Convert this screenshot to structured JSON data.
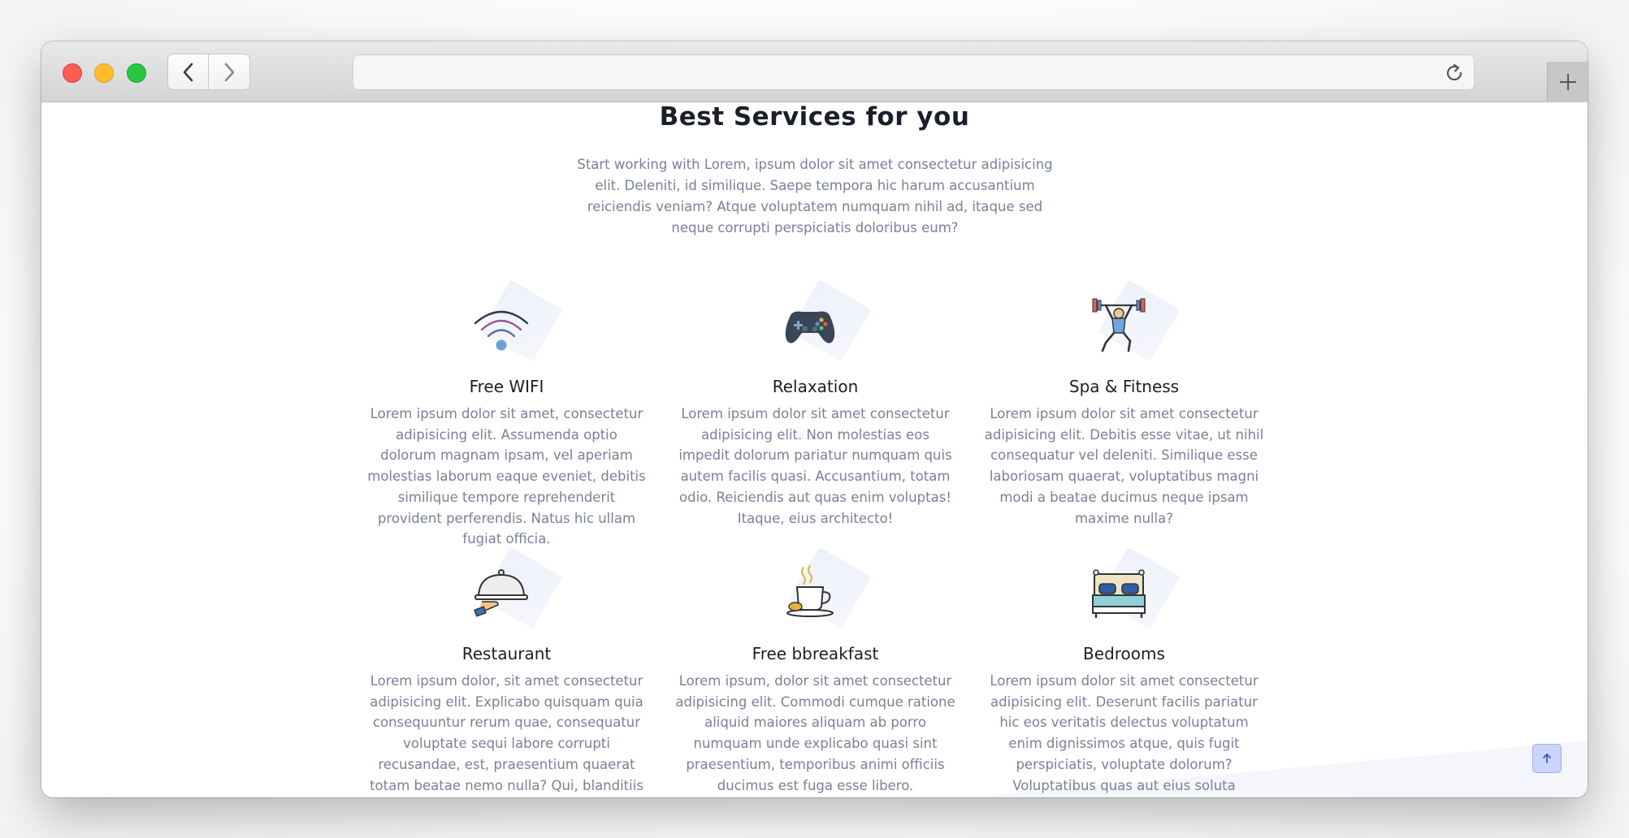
{
  "browser": {
    "url_value": "",
    "back_icon": "chevron-left-icon",
    "forward_icon": "chevron-right-icon",
    "reload_icon": "reload-icon",
    "newtab_icon": "plus-icon"
  },
  "section": {
    "title": "Best Services for you",
    "intro": "Start working with Lorem, ipsum dolor sit amet consectetur adipisicing elit. Deleniti, id similique. Saepe tempora hic harum accusantium reiciendis veniam? Atque voluptatem numquam nihil ad, itaque sed neque corrupti perspiciatis doloribus eum?"
  },
  "services": [
    {
      "icon": "wifi-icon",
      "title": "Free WIFI",
      "text": "Lorem ipsum dolor sit amet, consectetur adipisicing elit. Assumenda optio dolorum magnam ipsam, vel aperiam molestias laborum eaque eveniet, debitis similique tempore reprehenderit provident perferendis. Natus hic ullam fugiat officia."
    },
    {
      "icon": "gamepad-icon",
      "title": "Relaxation",
      "text": "Lorem ipsum dolor sit amet consectetur adipisicing elit. Non molestias eos impedit dolorum pariatur numquam quis autem facilis quasi. Accusantium, totam odio. Reiciendis aut quas enim voluptas! Itaque, eius architecto!"
    },
    {
      "icon": "weightlifter-icon",
      "title": "Spa & Fitness",
      "text": "Lorem ipsum dolor sit amet consectetur adipisicing elit. Debitis esse vitae, ut nihil consequatur vel deleniti. Similique esse laboriosam quaerat, voluptatibus magni modi a beatae ducimus neque ipsam maxime nulla?"
    },
    {
      "icon": "cloche-icon",
      "title": "Restaurant",
      "text": "Lorem ipsum dolor, sit amet consectetur adipisicing elit. Explicabo quisquam quia consequuntur rerum quae, consequatur voluptate sequi labore corrupti recusandae, est, praesentium quaerat totam beatae nemo nulla? Qui, blanditiis pariatur!"
    },
    {
      "icon": "coffee-cup-icon",
      "title": "Free bbreakfast",
      "text": "Lorem ipsum, dolor sit amet consectetur adipisicing elit. Commodi cumque ratione aliquid maiores aliquam ab porro numquam unde explicabo quasi sint praesentium, temporibus animi officiis ducimus est fuga esse libero."
    },
    {
      "icon": "bed-icon",
      "title": "Bedrooms",
      "text": "Lorem ipsum dolor sit amet consectetur adipisicing elit. Deserunt facilis pariatur hic eos veritatis delectus voluptatum enim dignissimos atque, quis fugit perspiciatis, voluptate dolorum? Voluptatibus quas aut eius soluta quibusdam!"
    }
  ],
  "scroll_top_icon": "arrow-up-icon",
  "colors": {
    "heading": "#1b1f2b",
    "body_text": "#7a8097",
    "accent": "#cbd4fb"
  }
}
